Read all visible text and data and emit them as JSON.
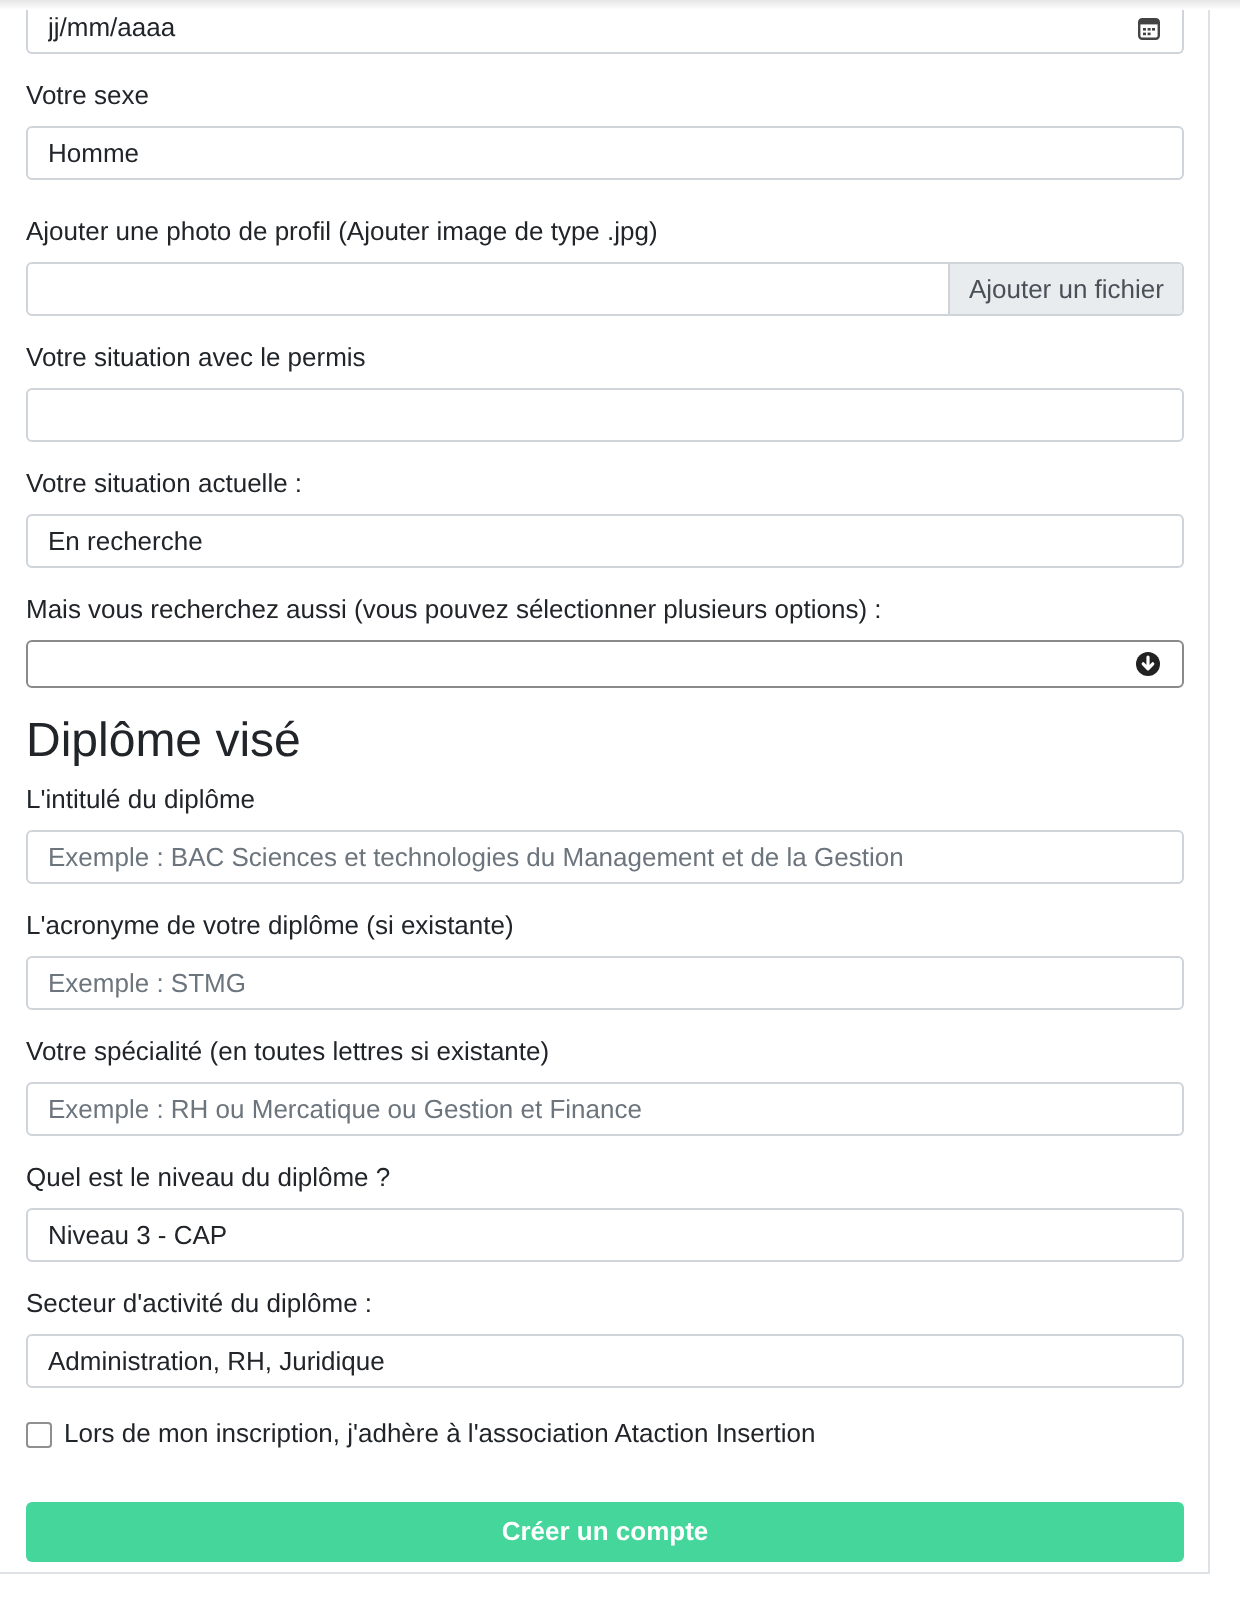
{
  "form_fields": [
    {
      "kind": "date",
      "placeholder": "jj/mm/aaaa"
    },
    {
      "kind": "text",
      "label": "Votre sexe",
      "value": "Homme"
    },
    {
      "kind": "file",
      "label": "Ajouter une photo de profil (Ajouter image de type .jpg)",
      "button": "Ajouter un fichier"
    },
    {
      "kind": "text",
      "label": "Votre situation avec le permis"
    },
    {
      "kind": "text",
      "label": "Votre situation actuelle :",
      "value": "En recherche"
    },
    {
      "kind": "multiselect",
      "label": "Mais vous recherchez aussi (vous pouvez sélectionner plusieurs options) :"
    }
  ],
  "diploma_section": {
    "heading": "Diplôme visé",
    "fields": [
      {
        "kind": "text",
        "label": "L'intitulé du diplôme",
        "placeholder": "Exemple : BAC Sciences et technologies du Management et de la Gestion"
      },
      {
        "kind": "text",
        "label": "L'acronyme de votre diplôme (si existante)",
        "placeholder": "Exemple : STMG"
      },
      {
        "kind": "text",
        "label": "Votre spécialité (en toutes lettres si existante)",
        "placeholder": "Exemple : RH ou Mercatique ou Gestion et Finance"
      },
      {
        "kind": "text",
        "label": "Quel est le niveau du diplôme ?",
        "value": "Niveau 3 - CAP"
      },
      {
        "kind": "text",
        "label": "Secteur d'activité du diplôme :",
        "value": "Administration, RH, Juridique"
      }
    ]
  },
  "membership_checkbox": {
    "label": "Lors de mon inscription, j'adhère à l'association Ataction Insertion",
    "checked": false
  },
  "submit_button": "Créer un compte"
}
